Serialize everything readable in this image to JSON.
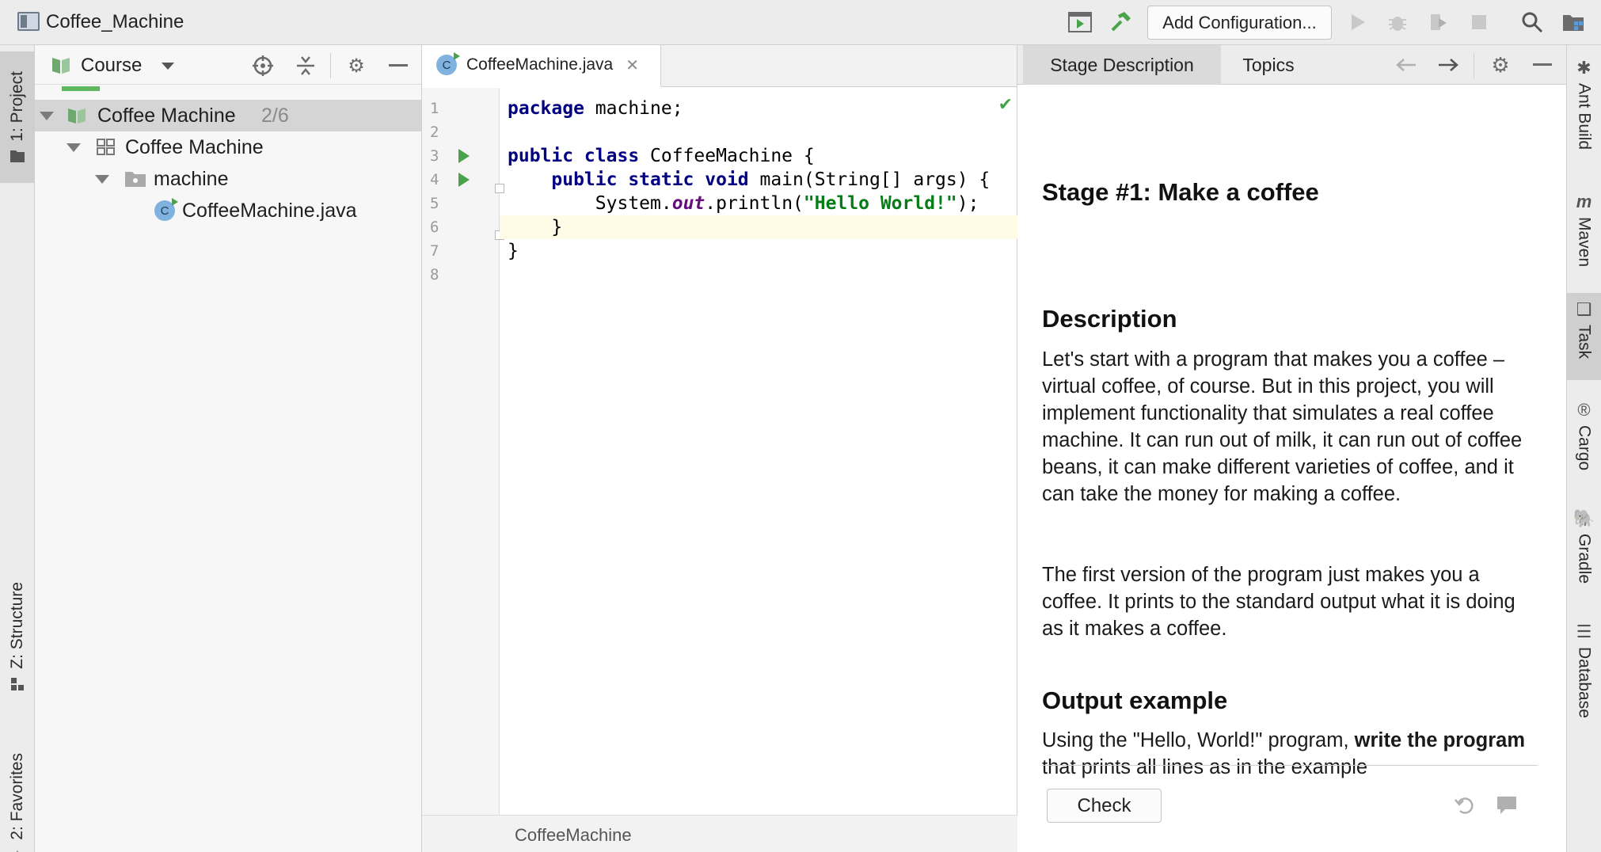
{
  "window": {
    "title": "Coffee_Machine"
  },
  "toolbar": {
    "add_configuration_label": "Add Configuration..."
  },
  "left_strip": {
    "tabs": [
      {
        "label": "1: Project"
      },
      {
        "label": "Z: Structure"
      },
      {
        "label": "2: Favorites"
      }
    ]
  },
  "project_panel": {
    "view_selector": "Course",
    "tree": [
      {
        "label": "Coffee Machine",
        "extra": "2/6"
      },
      {
        "label": "Coffee Machine"
      },
      {
        "label": "machine"
      },
      {
        "label": "CoffeeMachine.java"
      }
    ]
  },
  "editor": {
    "tab_label": "CoffeeMachine.java",
    "file_icon_letter": "C",
    "line_numbers": [
      "1",
      "2",
      "3",
      "4",
      "5",
      "6",
      "7",
      "8"
    ],
    "code": {
      "l1_kw": "package",
      "l1_rest": " machine;",
      "l3_kw": "public class",
      "l3_rest": " CoffeeMachine {",
      "l4_indent": "    ",
      "l4_kw": "public static void",
      "l4_rest": " main(String[] args) {",
      "l5_pre": "        System.",
      "l5_field": "out",
      "l5_mid": ".println(",
      "l5_str": "\"Hello World!\"",
      "l5_end": ");",
      "l6": "    }",
      "l7": "}"
    },
    "breadcrumb": "CoffeeMachine"
  },
  "task_panel": {
    "tabs": [
      "Stage Description",
      "Topics"
    ],
    "stage_title": "Stage #1: Make a coffee",
    "description_heading": "Description",
    "description_p1": "Let's start with a program that makes you a coffee – virtual coffee, of course. But in this project, you will implement functionality that simulates a real coffee machine. It can run out of milk, it can run out of coffee beans, it can make different varieties of coffee, and it can take the money for making a coffee.",
    "description_p2": "The first version of the program just makes you a coffee. It prints to the standard output what it is doing as it makes a coffee.",
    "output_heading": "Output example",
    "output_p_pre": "Using the \"Hello, World!\" program, ",
    "output_p_bold": "write the program",
    "output_p_post": " that prints all lines as in the example",
    "check_label": "Check"
  },
  "right_strip": {
    "tabs": [
      {
        "label": "Ant Build"
      },
      {
        "label": "Maven"
      },
      {
        "label": "Task"
      },
      {
        "label": "Cargo"
      },
      {
        "label": "Gradle"
      },
      {
        "label": "Database"
      }
    ]
  },
  "colors": {
    "accent_green": "#4aa34a",
    "keyword": "#000080",
    "string": "#067d17",
    "field": "#660e7a",
    "current_line": "#fefbe6"
  }
}
